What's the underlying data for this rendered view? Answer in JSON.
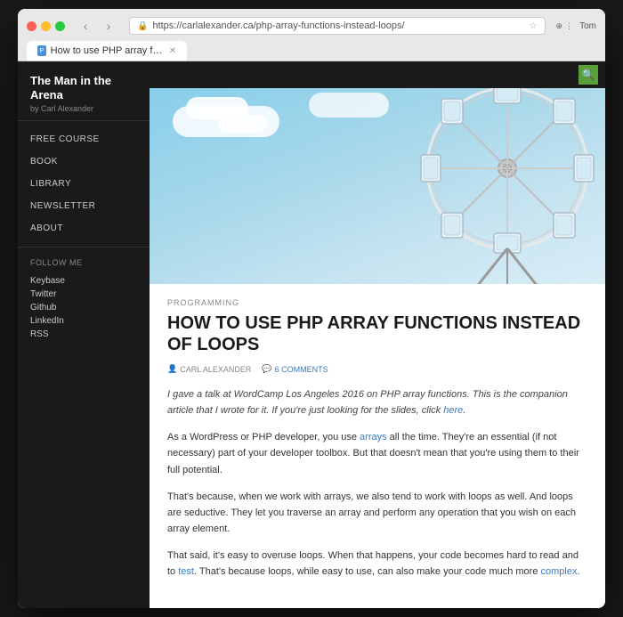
{
  "browser": {
    "tab_title": "How to use PHP array function...",
    "url": "https://carlalexander.ca/php-array-functions-instead-loops/",
    "user": "Tom"
  },
  "sidebar": {
    "site_title": "The Man in the Arena",
    "site_subtitle": "by Carl Alexander",
    "nav_items": [
      {
        "label": "FREE COURSE"
      },
      {
        "label": "BOOK"
      },
      {
        "label": "LIBRARY"
      },
      {
        "label": "NEWSLETTER"
      },
      {
        "label": "ABOUT"
      }
    ],
    "follow_section_title": "FOLLOW ME",
    "social_links": [
      {
        "label": "Keybase"
      },
      {
        "label": "Twitter"
      },
      {
        "label": "Github"
      },
      {
        "label": "LinkedIn"
      },
      {
        "label": "RSS"
      }
    ],
    "search_icon": "🔍"
  },
  "article": {
    "category": "PROGRAMMING",
    "title": "HOW TO USE PHP ARRAY FUNCTIONS INSTEAD OF LOOPS",
    "author": "CARL ALEXANDER",
    "comments": "6 COMMENTS",
    "intro": "I gave a talk at WordCamp Los Angeles 2016 on PHP array functions. This is the companion article that I wrote for it. If you're just looking for the slides, click here.",
    "p1": "As a WordPress or PHP developer, you use arrays all the time. They're an essential (if not necessary) part of your developer toolbox. But that doesn't mean that you're using them to their full potential.",
    "p2": "That's because, when we work with arrays, we also tend to work with loops as well. And loops are seductive. They let you traverse an array and perform any operation that you wish on each array element.",
    "p3": "That said, it's easy to overuse loops. When that happens, your code becomes hard to read and to test. That's because loops, while easy to use, can also make your code much more complex.",
    "link_here": "here",
    "link_arrays": "arrays",
    "link_test": "test",
    "link_complex": "complex"
  }
}
